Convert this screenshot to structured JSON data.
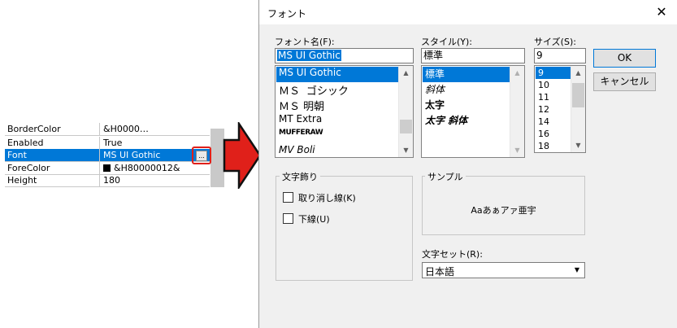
{
  "property_grid": {
    "rows": [
      {
        "name": "BorderColor",
        "value": "&H0000…"
      },
      {
        "name": "Enabled",
        "value": "True"
      },
      {
        "name": "Font",
        "value": "MS UI Gothic",
        "selected": true
      },
      {
        "name": "ForeColor",
        "value": "&H80000012&",
        "swatch": "#000000"
      },
      {
        "name": "Height",
        "value": "180"
      }
    ],
    "ellipsis_label": "..."
  },
  "arrow_color": "#e0201a",
  "dialog": {
    "title": "フォント",
    "close_label": "✕",
    "font_name": {
      "label": "フォント名(F):",
      "value": "MS UI Gothic",
      "items": [
        "MS UI Gothic",
        "ＭＳ ゴシック",
        "ＭＳ 明朝",
        "MT Extra",
        "MUFFERAW",
        "MV Boli"
      ],
      "selected_index": 0
    },
    "style": {
      "label": "スタイル(Y):",
      "value": "標準",
      "items": [
        "標準",
        "斜体",
        "太字",
        "太字 斜体"
      ],
      "selected_index": 0
    },
    "size": {
      "label": "サイズ(S):",
      "value": "9",
      "items": [
        "9",
        "10",
        "11",
        "12",
        "14",
        "16",
        "18"
      ],
      "selected_index": 0
    },
    "ok_label": "OK",
    "cancel_label": "キャンセル",
    "effects": {
      "label": "文字飾り",
      "strikeout_label": "取り消し線(K)",
      "underline_label": "下線(U)"
    },
    "sample": {
      "label": "サンプル",
      "text": "Aaあぁアァ亜宇"
    },
    "charset": {
      "label": "文字セット(R):",
      "value": "日本語"
    },
    "accent_color": "#0078d7"
  }
}
